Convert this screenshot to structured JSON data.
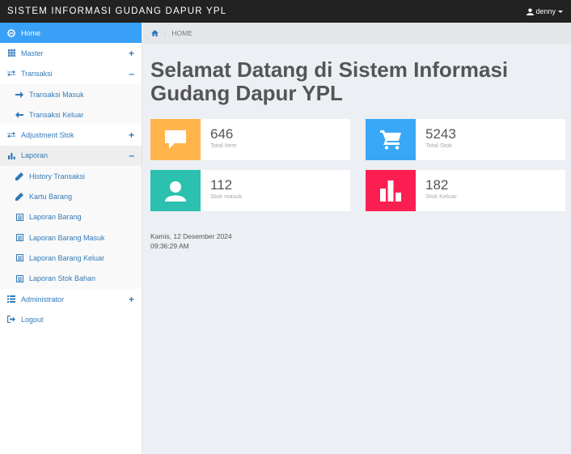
{
  "header": {
    "brand": "SISTEM INFORMASI GUDANG DAPUR YPL",
    "user": "denny"
  },
  "sidebar": {
    "items": [
      {
        "label": "Home"
      },
      {
        "label": "Master",
        "toggle": "+"
      },
      {
        "label": "Transaksi",
        "toggle": "–"
      },
      {
        "label": "Transaksi Masuk"
      },
      {
        "label": "Transaksi Keluar"
      },
      {
        "label": "Adjustment Stok",
        "toggle": "+"
      },
      {
        "label": "Laporan",
        "toggle": "–"
      },
      {
        "label": "History Transaksi"
      },
      {
        "label": "Kartu Barang"
      },
      {
        "label": "Laporan Barang"
      },
      {
        "label": "Laporan Barang Masuk"
      },
      {
        "label": "Laporan Barang Keluar"
      },
      {
        "label": "Laporan Stok Bahan"
      },
      {
        "label": "Administrator",
        "toggle": "+"
      },
      {
        "label": "Logout"
      }
    ]
  },
  "breadcrumb": {
    "current": "HOME"
  },
  "main": {
    "title": "Selamat Datang di Sistem Informasi Gudang Dapur YPL",
    "cards": [
      {
        "value": "646",
        "label": "Total Item",
        "color": "#ffb54c",
        "icon": "comment-icon"
      },
      {
        "value": "5243",
        "label": "Total Stok",
        "color": "#38a8f6",
        "icon": "cart-icon"
      },
      {
        "value": "112",
        "label": "Stok masuk",
        "color": "#2bc0b0",
        "icon": "user-icon"
      },
      {
        "value": "182",
        "label": "Stok Keluar",
        "color": "#fb1f51",
        "icon": "bar-chart-icon"
      }
    ],
    "date": "Kamis, 12 Desember 2024",
    "time": "09:36:29 AM"
  }
}
